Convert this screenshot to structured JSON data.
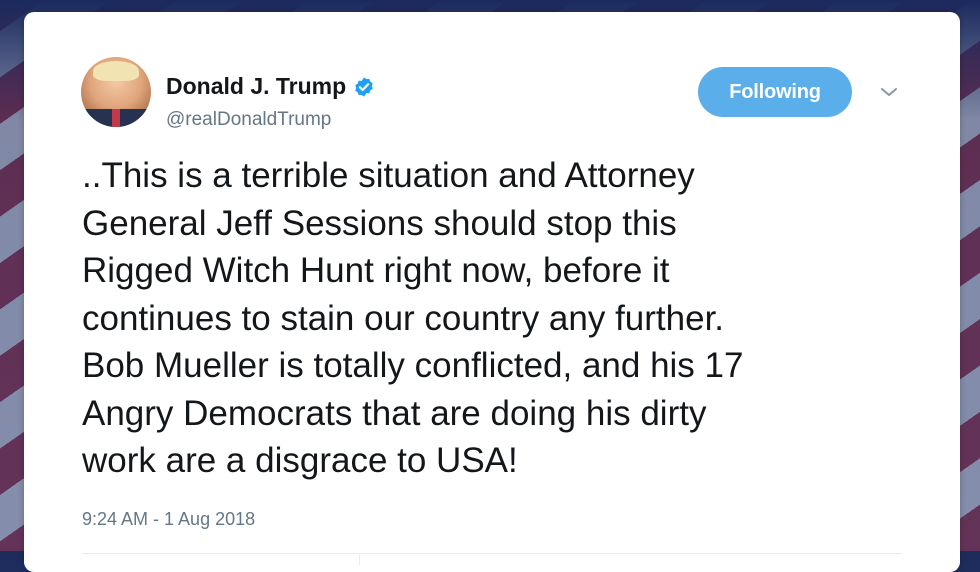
{
  "tweet": {
    "author_name": "Donald J. Trump",
    "author_handle": "@realDonaldTrump",
    "follow_label": "Following",
    "text": "..This is a terrible situation and Attorney\nGeneral Jeff Sessions should stop this\nRigged Witch Hunt right now, before it\ncontinues to stain our country any further.\nBob Mueller is totally conflicted, and his 17\nAngry Democrats that are doing his dirty\nwork are a disgrace to USA!",
    "timestamp": "9:24 AM - 1 Aug 2018"
  },
  "icons": {
    "verified": "verified-badge-icon",
    "menu": "chevron-down-icon"
  },
  "colors": {
    "accent": "#5aaeea",
    "verified": "#1da1f2",
    "text": "#14171a",
    "muted": "#657786"
  }
}
